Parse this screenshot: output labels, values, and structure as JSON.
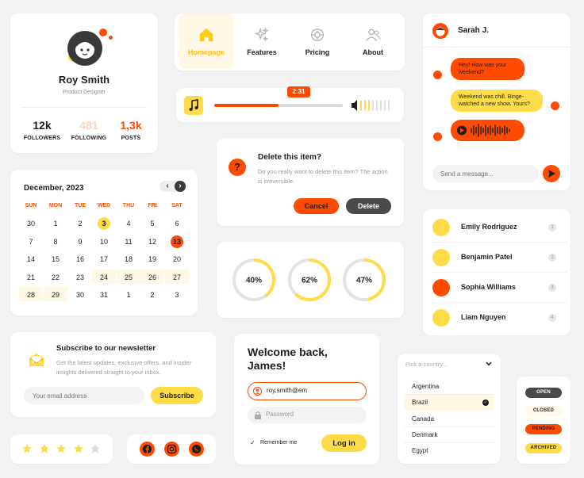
{
  "profile": {
    "name": "Roy Smith",
    "role": "Product Designer",
    "stats": [
      {
        "value": "12k",
        "label": "FOLLOWERS"
      },
      {
        "value": "481",
        "label": "FOLLOWING"
      },
      {
        "value": "1,3k",
        "label": "POSTS"
      }
    ]
  },
  "nav": {
    "items": [
      {
        "label": "Homepage",
        "icon": "home-icon",
        "active": true
      },
      {
        "label": "Features",
        "icon": "sparkles-icon",
        "active": false
      },
      {
        "label": "Pricing",
        "icon": "badge-icon",
        "active": false
      },
      {
        "label": "About",
        "icon": "users-icon",
        "active": false
      }
    ]
  },
  "player": {
    "time": "2:31",
    "progress": 0.5,
    "icon": "music-note-icon"
  },
  "dialog": {
    "title": "Delete this item?",
    "body": "Do you really want to delete this item? The action is irreversible.",
    "cancel_label": "Cancel",
    "delete_label": "Delete"
  },
  "calendar": {
    "title": "December, 2023",
    "weekdays": [
      "SUN",
      "MON",
      "TUE",
      "WED",
      "THU",
      "FRI",
      "SAT"
    ],
    "weeks": [
      [
        "30",
        "1",
        "2",
        "3",
        "4",
        "5",
        "6"
      ],
      [
        "7",
        "8",
        "9",
        "10",
        "11",
        "12",
        "13"
      ],
      [
        "14",
        "15",
        "16",
        "17",
        "18",
        "19",
        "20"
      ],
      [
        "21",
        "22",
        "23",
        "24",
        "25",
        "26",
        "27"
      ],
      [
        "28",
        "29",
        "30",
        "31",
        "1",
        "2",
        "3"
      ]
    ]
  },
  "progress_rings": [
    {
      "label": "40%",
      "value": 0.4
    },
    {
      "label": "62%",
      "value": 0.62
    },
    {
      "label": "47%",
      "value": 0.47
    }
  ],
  "chat": {
    "contact": "Sarah J.",
    "messages": [
      {
        "from": "them",
        "text": "Hey! How was your weekend?"
      },
      {
        "from": "me",
        "text": "Weekend was chill. Binge-watched a new show. Yours?"
      },
      {
        "from": "them",
        "type": "voice"
      }
    ],
    "input_placeholder": "Send a message..."
  },
  "people": [
    {
      "name": "Emily Rodriguez",
      "num": "1",
      "color": "#ffdc47"
    },
    {
      "name": "Benjamin Patel",
      "num": "2",
      "color": "#ffdc47"
    },
    {
      "name": "Sophia Williams",
      "num": "3",
      "color": "#ff4b00"
    },
    {
      "name": "Liam Nguyen",
      "num": "4",
      "color": "#ffdc47"
    }
  ],
  "newsletter": {
    "title": "Subscribe to our newsletter",
    "body": "Get the latest updates, exclusive offers, and insider insights delivered straight to your inbox.",
    "email_placeholder": "Your email address",
    "button_label": "Subscribe"
  },
  "login": {
    "title": "Welcome back, James!",
    "email_value": "roy.smith@em",
    "password_placeholder": "Password",
    "remember_label": "Remember me",
    "button_label": "Log in"
  },
  "country_select": {
    "placeholder": "Pick a country...",
    "options": [
      "Argentina",
      "Brazil",
      "Canada",
      "Denmark",
      "Egypt"
    ],
    "selected": "Brazil"
  },
  "statuses": [
    "OPEN",
    "CLOSED",
    "PENDING",
    "ARCHIVED"
  ],
  "rating": {
    "value": 4,
    "max": 5
  },
  "social": [
    "facebook-icon",
    "instagram-icon",
    "whatsapp-icon"
  ],
  "colors": {
    "accent": "#ff4b00",
    "yellow": "#ffdc47",
    "dark": "#3a3a3a"
  }
}
